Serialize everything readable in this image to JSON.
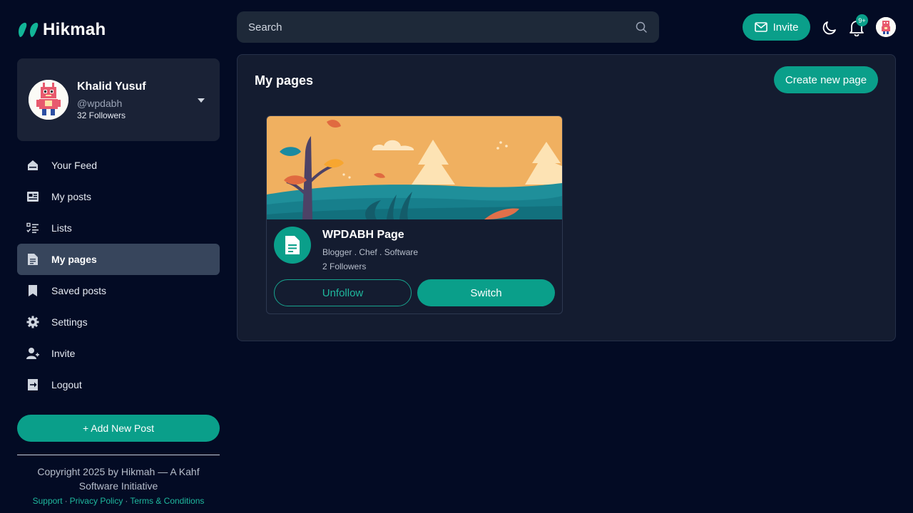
{
  "app": {
    "logo_text": "Hikmah",
    "accent": "#0a9f8a",
    "background": "#030b24"
  },
  "header": {
    "search_placeholder": "Search",
    "invite_label": "Invite",
    "notification_badge": "9+"
  },
  "profile": {
    "name": "Khalid Yusuf",
    "handle": "@wpdabh",
    "followers": "32 Followers"
  },
  "sidebar": {
    "items": [
      {
        "label": "Your Feed",
        "icon": "home-icon",
        "active": false
      },
      {
        "label": "My posts",
        "icon": "posts-icon",
        "active": false
      },
      {
        "label": "Lists",
        "icon": "checklist-icon",
        "active": false
      },
      {
        "label": "My pages",
        "icon": "document-icon",
        "active": true
      },
      {
        "label": "Saved posts",
        "icon": "bookmark-icon",
        "active": false
      },
      {
        "label": "Settings",
        "icon": "gear-icon",
        "active": false
      },
      {
        "label": "Invite",
        "icon": "add-user-icon",
        "active": false
      },
      {
        "label": "Logout",
        "icon": "logout-icon",
        "active": false
      }
    ],
    "add_post_label": "+ Add New Post",
    "copyright": "Copyright 2025 by Hikmah — A Kahf Software Initiative",
    "footer_links": [
      "Support",
      "Privacy Policy",
      "Terms & Conditions"
    ]
  },
  "main": {
    "title": "My pages",
    "create_label": "Create new page",
    "pages": [
      {
        "name": "WPDABH Page",
        "tags": "Blogger . Chef . Software",
        "followers": "2 Followers",
        "unfollow_label": "Unfollow",
        "switch_label": "Switch"
      }
    ]
  }
}
